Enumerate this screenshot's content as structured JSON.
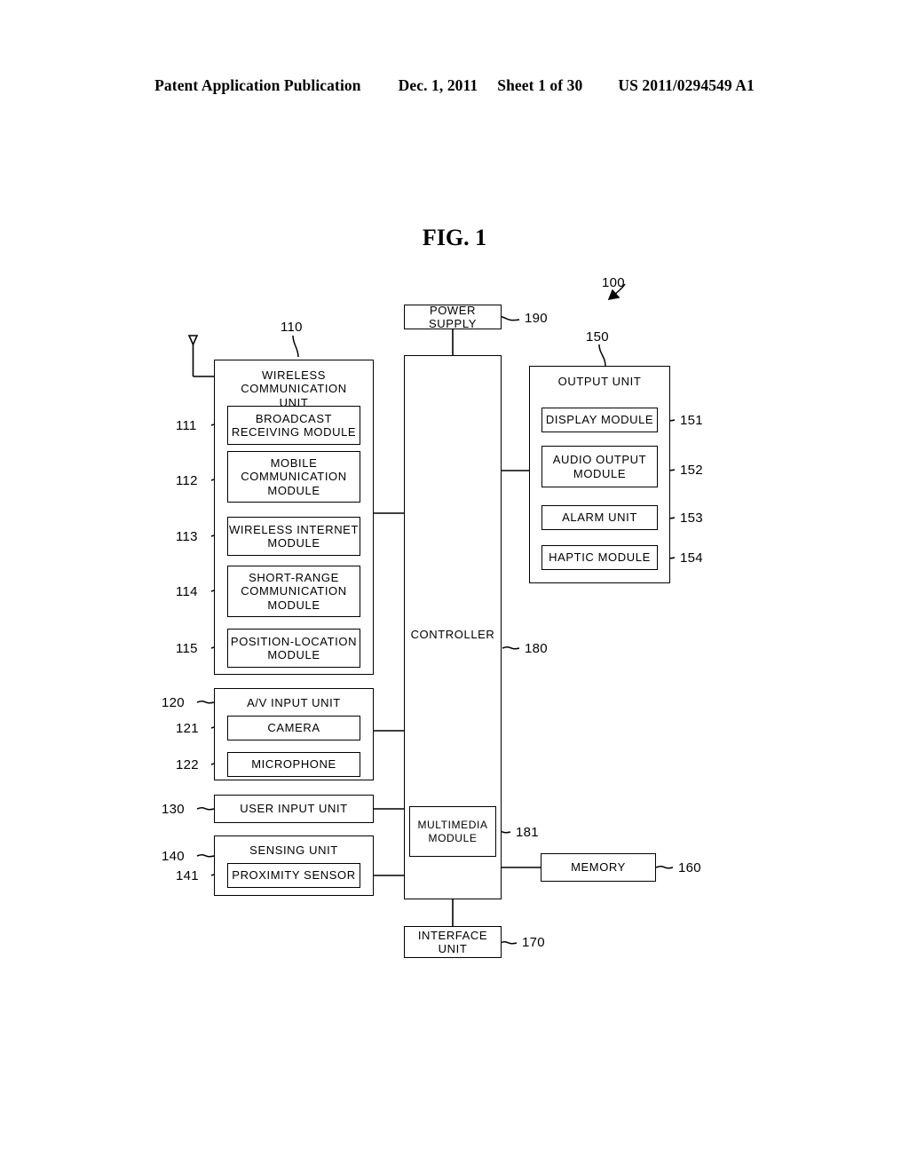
{
  "header": {
    "publication": "Patent Application Publication",
    "date": "Dec. 1, 2011",
    "sheet": "Sheet 1 of 30",
    "patent_number": "US 2011/0294549 A1"
  },
  "figure": {
    "title": "FIG. 1",
    "system_ref": "100"
  },
  "blocks": {
    "power_supply": {
      "label": "POWER SUPPLY",
      "ref": "190"
    },
    "wireless_unit": {
      "label": "WIRELESS COMMUNICATION\nUNIT",
      "ref": "110"
    },
    "broadcast_receiving": {
      "label": "BROADCAST\nRECEIVING MODULE",
      "ref": "111"
    },
    "mobile_communication": {
      "label": "MOBILE\nCOMMUNICATION\nMODULE",
      "ref": "112"
    },
    "wireless_internet": {
      "label": "WIRELESS INTERNET\nMODULE",
      "ref": "113"
    },
    "short_range": {
      "label": "SHORT-RANGE\nCOMMUNICATION\nMODULE",
      "ref": "114"
    },
    "position_location": {
      "label": "POSITION-LOCATION\nMODULE",
      "ref": "115"
    },
    "av_input_unit": {
      "label": "A/V INPUT UNIT",
      "ref": "120"
    },
    "camera": {
      "label": "CAMERA",
      "ref": "121"
    },
    "microphone": {
      "label": "MICROPHONE",
      "ref": "122"
    },
    "user_input_unit": {
      "label": "USER INPUT UNIT",
      "ref": "130"
    },
    "sensing_unit": {
      "label": "SENSING UNIT",
      "ref": "140"
    },
    "proximity_sensor": {
      "label": "PROXIMITY SENSOR",
      "ref": "141"
    },
    "output_unit": {
      "label": "OUTPUT UNIT",
      "ref": "150"
    },
    "display_module": {
      "label": "DISPLAY MODULE",
      "ref": "151"
    },
    "audio_output_module": {
      "label": "AUDIO OUTPUT\nMODULE",
      "ref": "152"
    },
    "alarm_unit": {
      "label": "ALARM UNIT",
      "ref": "153"
    },
    "haptic_module": {
      "label": "HAPTIC MODULE",
      "ref": "154"
    },
    "memory": {
      "label": "MEMORY",
      "ref": "160"
    },
    "interface_unit": {
      "label": "INTERFACE UNIT",
      "ref": "170"
    },
    "controller": {
      "label": "CONTROLLER",
      "ref": "180"
    },
    "multimedia_module": {
      "label": "MULTIMEDIA\nMODULE",
      "ref": "181"
    }
  }
}
